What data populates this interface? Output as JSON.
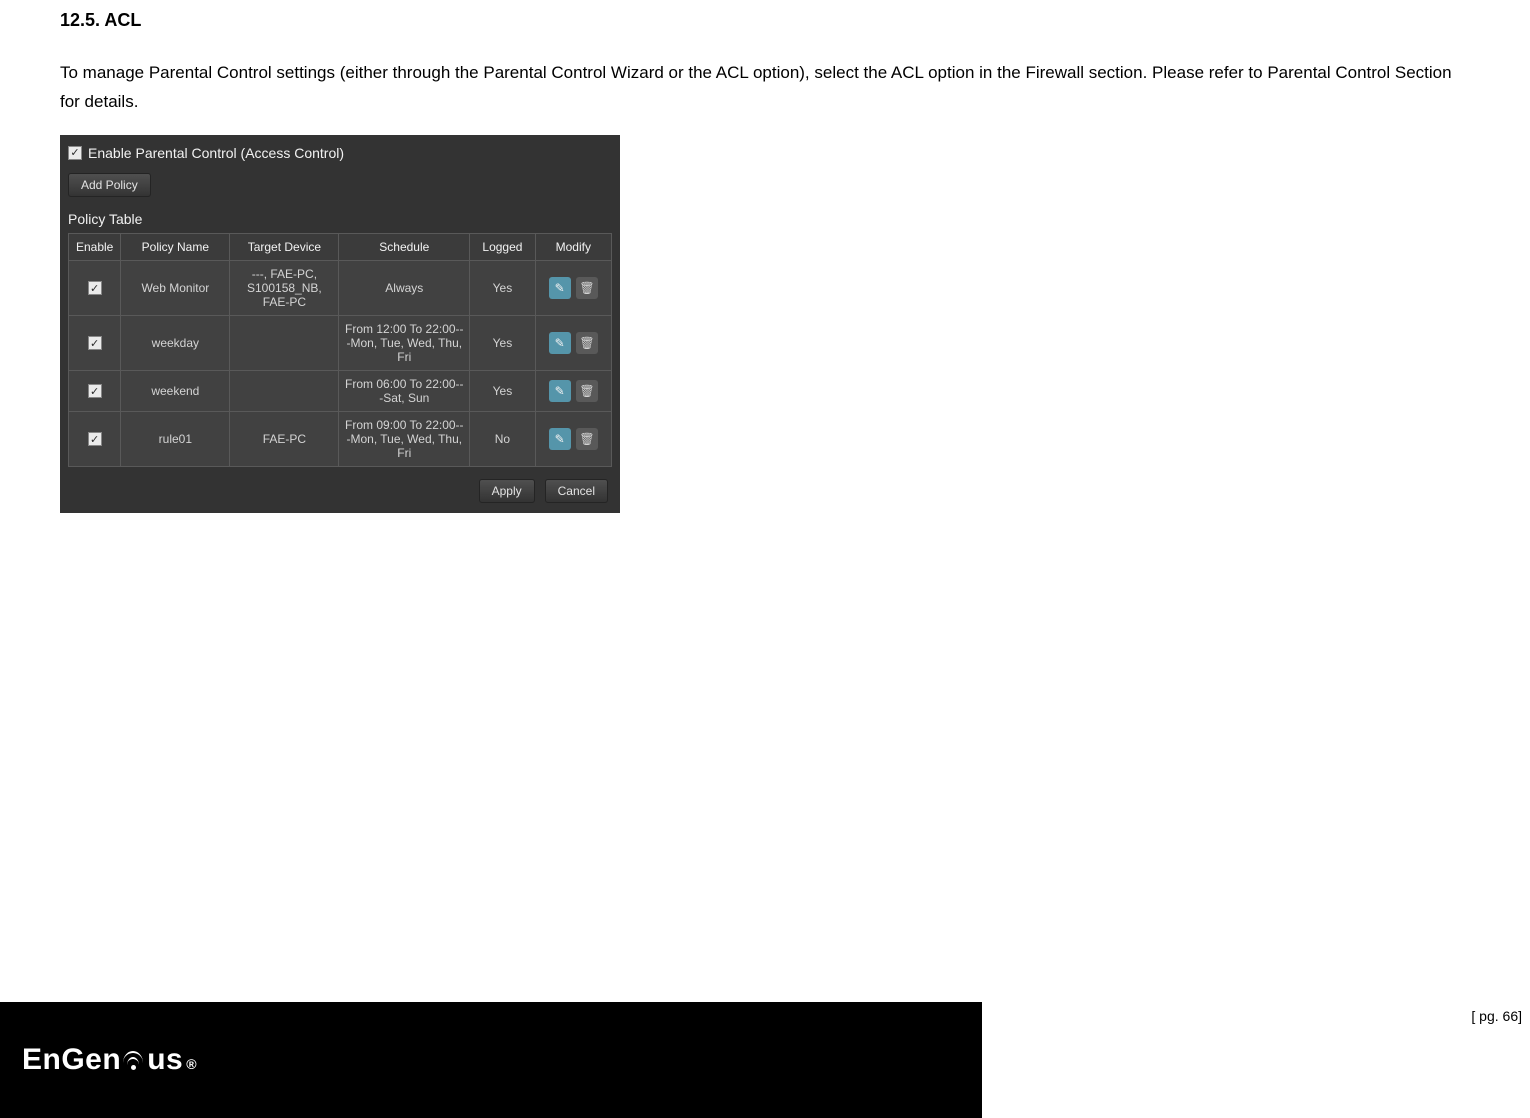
{
  "section": {
    "title": "12.5.  ACL",
    "body": "To manage Parental Control settings (either through the Parental Control Wizard or the ACL option), select the ACL option in the Firewall section. Please refer to Parental Control Section for details."
  },
  "panel": {
    "enable_label": "Enable Parental Control (Access Control)",
    "enable_checked": "✓",
    "add_policy_label": "Add Policy",
    "table_title": "Policy Table",
    "columns": {
      "enable": "Enable",
      "policy_name": "Policy Name",
      "target_device": "Target Device",
      "schedule": "Schedule",
      "logged": "Logged",
      "modify": "Modify"
    },
    "rows": [
      {
        "enable": "✓",
        "name": "Web Monitor",
        "device": "---, FAE-PC, S100158_NB, FAE-PC",
        "schedule": "Always",
        "logged": "Yes"
      },
      {
        "enable": "✓",
        "name": "weekday",
        "device": "",
        "schedule": "From 12:00 To 22:00---Mon, Tue, Wed, Thu, Fri",
        "logged": "Yes"
      },
      {
        "enable": "✓",
        "name": "weekend",
        "device": "",
        "schedule": "From 06:00 To 22:00---Sat, Sun",
        "logged": "Yes"
      },
      {
        "enable": "✓",
        "name": "rule01",
        "device": "FAE-PC",
        "schedule": "From 09:00 To 22:00---Mon, Tue, Wed, Thu, Fri",
        "logged": "No"
      }
    ],
    "apply_label": "Apply",
    "cancel_label": "Cancel"
  },
  "footer": {
    "logo_text": "EnGenius",
    "page_num": "[ pg. 66]"
  }
}
